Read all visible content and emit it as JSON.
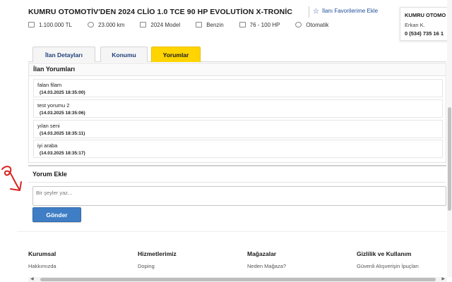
{
  "listing": {
    "title": "KUMRU OTOMOTİV'DEN 2024 CLİO 1.0 TCE 90 HP EVOLUTİON X-TRONİC",
    "favorite_label": "İlanı Favorilerime Ekle",
    "specs": [
      {
        "icon": "price-tag-icon",
        "value": "1.100.000 TL"
      },
      {
        "icon": "speedometer-icon",
        "value": "23.000 km"
      },
      {
        "icon": "calendar-icon",
        "value": "2024 Model"
      },
      {
        "icon": "fuel-pump-icon",
        "value": "Benzin"
      },
      {
        "icon": "engine-icon",
        "value": "76 - 100 HP"
      },
      {
        "icon": "gearbox-icon",
        "value": "Otomatik"
      }
    ]
  },
  "seller": {
    "name": "KUMRU OTOMO",
    "person": "Erkan K.",
    "phone": "0 (534) 735 16 1"
  },
  "tabs": [
    {
      "label": "İlan Detayları",
      "active": false
    },
    {
      "label": "Konumu",
      "active": false
    },
    {
      "label": "Yorumlar",
      "active": true
    }
  ],
  "comments_section": {
    "title": "İlan Yorumları",
    "comments": [
      {
        "text": "falan filam",
        "date": "(14.03.2025 18:35:00)"
      },
      {
        "text": "test yorumu 2",
        "date": "(14.03.2025 18:35:06)"
      },
      {
        "text": "yılan seni",
        "date": "(14.03.2025 18:35:11)"
      },
      {
        "text": "iyi araba",
        "date": "(14.03.2025 18:35:17)"
      }
    ]
  },
  "add_comment": {
    "title": "Yorum Ekle",
    "placeholder": "Bir şeyler yaz...",
    "value": "",
    "submit_label": "Gönder"
  },
  "footer": {
    "columns": [
      {
        "heading": "Kurumsal",
        "link": "Hakkımızda"
      },
      {
        "heading": "Hizmetlerimiz",
        "link": "Doping"
      },
      {
        "heading": "Mağazalar",
        "link": "Neden Mağaza?"
      },
      {
        "heading": "Gizlilik ve Kullanım",
        "link": "Güvenli Alışverişin İpuçları"
      }
    ]
  },
  "colors": {
    "accent_yellow": "#ffd400",
    "link_blue": "#1f4f96",
    "button_blue": "#3f7ec4",
    "annotation_red": "#d8231f"
  }
}
